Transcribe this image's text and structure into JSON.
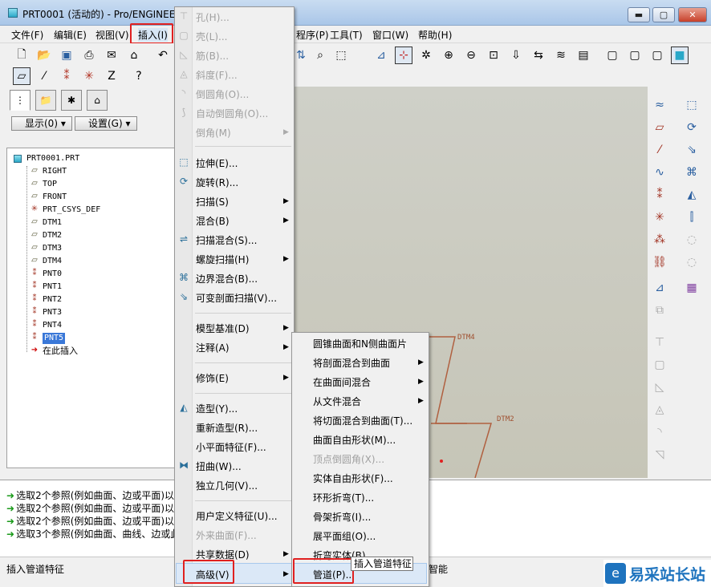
{
  "window": {
    "title": "PRT0001 (活动的) - Pro/ENGINEER",
    "min": "▬",
    "max": "▢",
    "close": "✕",
    "accent": "#1e73be"
  },
  "menubar": [
    "文件(F)",
    "编辑(E)",
    "视图(V)",
    "插入(I)",
    "程序(P)",
    "工具(T)",
    "窗口(W)",
    "帮助(H)"
  ],
  "panel": {
    "show": "显示(0)",
    "settings": "设置(G)"
  },
  "tree": [
    "PRT0001.PRT",
    "RIGHT",
    "TOP",
    "FRONT",
    "PRT_CSYS_DEF",
    "DTM1",
    "DTM2",
    "DTM3",
    "DTM4",
    "PNT0",
    "PNT1",
    "PNT2",
    "PNT3",
    "PNT4",
    "PNT5",
    "在此插入"
  ],
  "graphics": {
    "dtm4": "DTM4",
    "dtm2": "DTM2"
  },
  "insert_menu": [
    {
      "label": "孔(H)...",
      "disabled": true,
      "icon": "hole-icon"
    },
    {
      "label": "壳(L)...",
      "disabled": true,
      "icon": "shell-icon"
    },
    {
      "label": "筋(B)...",
      "disabled": true,
      "icon": "rib-icon"
    },
    {
      "label": "斜度(F)...",
      "disabled": true,
      "icon": "draft-icon"
    },
    {
      "label": "倒圆角(O)...",
      "disabled": true,
      "icon": "round-icon"
    },
    {
      "label": "自动倒圆角(O)...",
      "disabled": true,
      "icon": "auto-round-icon"
    },
    {
      "label": "倒角(M)",
      "disabled": true,
      "sub": true
    },
    {
      "label": "拉伸(E)...",
      "icon": "extrude-icon"
    },
    {
      "label": "旋转(R)...",
      "icon": "revolve-icon"
    },
    {
      "label": "扫描(S)",
      "sub": true
    },
    {
      "label": "混合(B)",
      "sub": true
    },
    {
      "label": "扫描混合(S)...",
      "icon": "swept-blend-icon"
    },
    {
      "label": "螺旋扫描(H)",
      "sub": true
    },
    {
      "label": "边界混合(B)...",
      "icon": "boundary-blend-icon"
    },
    {
      "label": "可变剖面扫描(V)...",
      "icon": "var-sweep-icon"
    },
    {
      "label": "模型基准(D)",
      "sub": true
    },
    {
      "label": "注释(A)",
      "sub": true
    },
    {
      "label": "修饰(E)",
      "sub": true
    },
    {
      "label": "造型(Y)...",
      "icon": "style-icon"
    },
    {
      "label": "重新造型(R)..."
    },
    {
      "label": "小平面特征(F)..."
    },
    {
      "label": "扭曲(W)...",
      "icon": "warp-icon"
    },
    {
      "label": "独立几何(V)..."
    },
    {
      "label": "用户定义特征(U)..."
    },
    {
      "label": "外来曲面(F)...",
      "disabled": true
    },
    {
      "label": "共享数据(D)",
      "sub": true
    },
    {
      "label": "高级(V)",
      "sub": true
    }
  ],
  "advanced_menu": [
    {
      "label": "圆锥曲面和N侧曲面片"
    },
    {
      "label": "将剖面混合到曲面",
      "sub": true
    },
    {
      "label": "在曲面间混合",
      "sub": true
    },
    {
      "label": "从文件混合",
      "sub": true
    },
    {
      "label": "将切面混合到曲面(T)..."
    },
    {
      "label": "曲面自由形状(M)..."
    },
    {
      "label": "顶点倒圆角(X)...",
      "disabled": true
    },
    {
      "label": "实体自由形状(F)..."
    },
    {
      "label": "环形折弯(T)..."
    },
    {
      "label": "骨架折弯(I)..."
    },
    {
      "label": "展平面组(O)..."
    },
    {
      "label": "折弯实体(B)..."
    },
    {
      "label": "管道(P)..."
    }
  ],
  "tooltip": "插入管道特征",
  "messages": [
    "选取2个参照(例如曲面、边或平面)以",
    "选取2个参照(例如曲面、边或平面)以",
    "选取2个参照(例如曲面、边或平面)以",
    "选取3个参照(例如曲面、曲线、边或此"
  ],
  "status": {
    "text": "插入管道特征",
    "filter": "智能"
  },
  "watermark": "易采站长站"
}
